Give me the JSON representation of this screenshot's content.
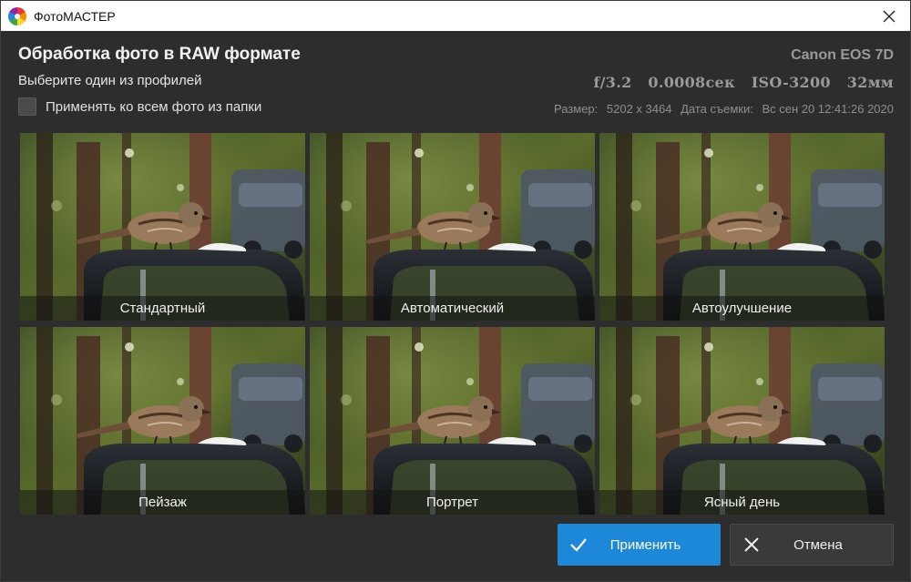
{
  "window": {
    "title": "ФотоМАСТЕР",
    "icon": "app-logo-icon"
  },
  "header": {
    "title": "Обработка фото в RAW формате",
    "subtitle": "Выберите один из профилей",
    "apply_all_label": "Применять ко всем фото из папки",
    "apply_all_checked": false
  },
  "camera": {
    "model": "Canon EOS 7D",
    "aperture": "f/3.2",
    "shutter": "0.0008сек",
    "iso": "ISO-3200",
    "focal": "32мм",
    "size_label": "Размер:",
    "size_value": "5202 x 3464",
    "date_label": "Дата съемки:",
    "date_value": "Вс сен 20 12:41:26 2020"
  },
  "profiles": [
    {
      "label": "Стандартный"
    },
    {
      "label": "Автоматический"
    },
    {
      "label": "Автоулучшение"
    },
    {
      "label": "Пейзаж"
    },
    {
      "label": "Портрет"
    },
    {
      "label": "Ясный день"
    }
  ],
  "actions": {
    "apply_label": "Применить",
    "cancel_label": "Отмена"
  },
  "colors": {
    "accent": "#1e88d8",
    "background": "#2d2d2d"
  }
}
